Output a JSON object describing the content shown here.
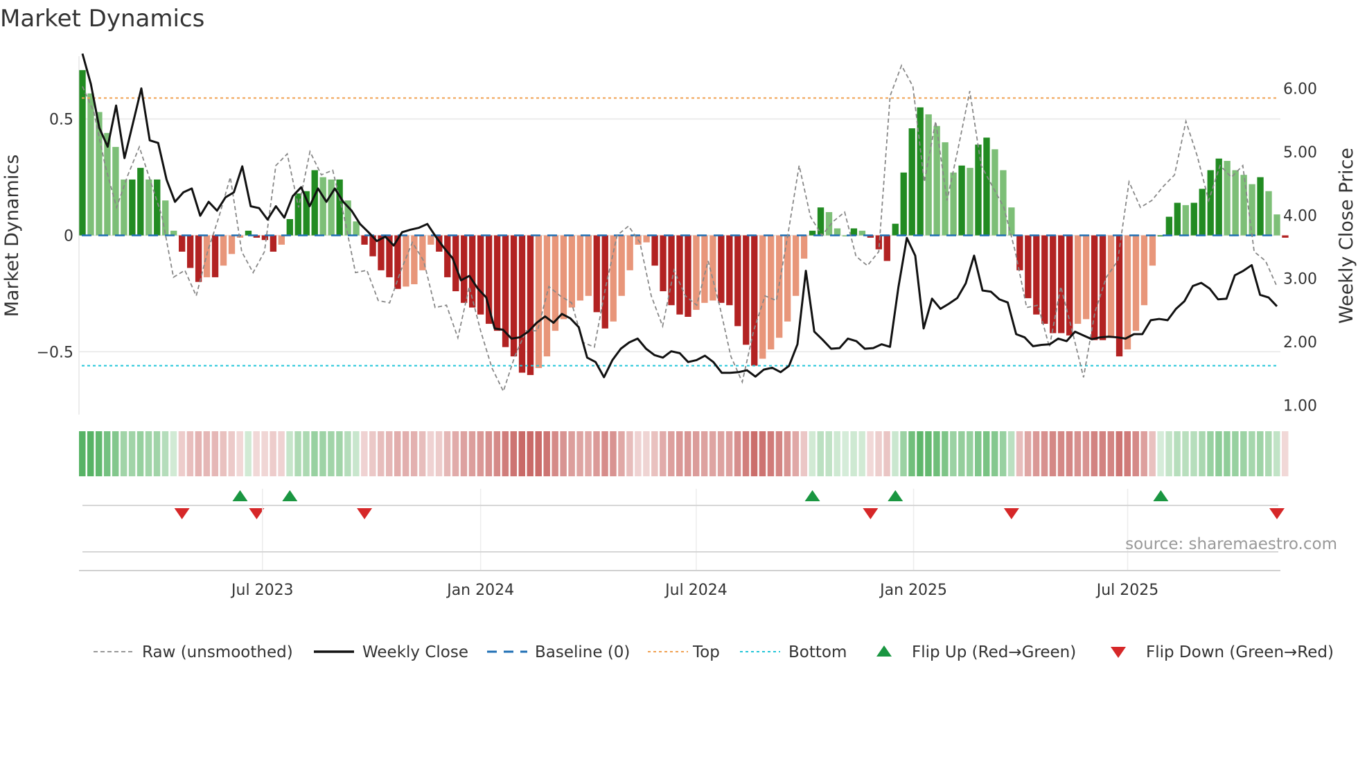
{
  "title": "Market Dynamics",
  "source": "source: sharemaestro.com",
  "colors": {
    "strong_up": "#228b22",
    "weak_up": "#7dbf77",
    "strong_down": "#b22222",
    "weak_down": "#e8967a",
    "raw": "#888888",
    "close": "#111111",
    "baseline": "#1f6fb4",
    "top": "#f0a050",
    "bottom": "#22c5d8",
    "flip_up": "#1a9641",
    "flip_down": "#d62728"
  },
  "chart_data": {
    "type": "bar",
    "title": "Market Dynamics",
    "ylabel": "Market Dynamics",
    "y2label": "Weekly Close Price",
    "ylim": [
      -0.77,
      0.77
    ],
    "y2lim": [
      0.85,
      6.51
    ],
    "yticks": [
      {
        "v": 0.5,
        "label": "0.5"
      },
      {
        "v": 0,
        "label": "0"
      },
      {
        "v": -0.5,
        "label": "−0.5"
      }
    ],
    "y2ticks": [
      {
        "v": 6,
        "label": "6.00"
      },
      {
        "v": 5,
        "label": "5.00"
      },
      {
        "v": 4,
        "label": "4.00"
      },
      {
        "v": 3,
        "label": "3.00"
      },
      {
        "v": 2,
        "label": "2.00"
      },
      {
        "v": 1,
        "label": "1.00"
      }
    ],
    "xticks": [
      {
        "week": 21.7,
        "label": "Jul 2023"
      },
      {
        "week": 48,
        "label": "Jan 2024"
      },
      {
        "week": 74,
        "label": "Jul 2024"
      },
      {
        "week": 100.2,
        "label": "Jan 2025"
      },
      {
        "week": 126,
        "label": "Jul 2025"
      }
    ],
    "n_weeks": 145,
    "top_level": 0.59,
    "bottom_level": -0.56,
    "baseline": 0,
    "dynamics": [
      0.71,
      0.61,
      0.53,
      0.44,
      0.38,
      0.24,
      0.24,
      0.29,
      0.24,
      0.24,
      0.15,
      0.02,
      -0.07,
      -0.14,
      -0.2,
      -0.18,
      -0.18,
      -0.13,
      -0.08,
      -0.01,
      0.02,
      -0.01,
      -0.02,
      -0.07,
      -0.04,
      0.07,
      0.18,
      0.19,
      0.28,
      0.25,
      0.24,
      0.24,
      0.15,
      0.06,
      -0.04,
      -0.09,
      -0.15,
      -0.18,
      -0.23,
      -0.22,
      -0.21,
      -0.15,
      -0.04,
      -0.07,
      -0.18,
      -0.24,
      -0.29,
      -0.31,
      -0.34,
      -0.38,
      -0.41,
      -0.48,
      -0.52,
      -0.59,
      -0.6,
      -0.57,
      -0.52,
      -0.41,
      -0.36,
      -0.31,
      -0.28,
      -0.26,
      -0.33,
      -0.4,
      -0.37,
      -0.26,
      -0.15,
      -0.04,
      -0.03,
      -0.13,
      -0.24,
      -0.3,
      -0.34,
      -0.35,
      -0.32,
      -0.29,
      -0.28,
      -0.29,
      -0.3,
      -0.39,
      -0.47,
      -0.56,
      -0.53,
      -0.49,
      -0.44,
      -0.37,
      -0.26,
      -0.1,
      0.02,
      0.12,
      0.1,
      0.03,
      0.0,
      0.03,
      0.02,
      -0.01,
      -0.06,
      -0.11,
      0.05,
      0.27,
      0.46,
      0.55,
      0.52,
      0.47,
      0.4,
      0.27,
      0.3,
      0.29,
      0.39,
      0.42,
      0.37,
      0.28,
      0.12,
      -0.15,
      -0.27,
      -0.34,
      -0.38,
      -0.42,
      -0.42,
      -0.43,
      -0.38,
      -0.36,
      -0.45,
      -0.45,
      -0.44,
      -0.52,
      -0.49,
      -0.41,
      -0.3,
      -0.13,
      0.0,
      0.08,
      0.14,
      0.13,
      0.14,
      0.2,
      0.28,
      0.33,
      0.32,
      0.28,
      0.26,
      0.22,
      0.25,
      0.19,
      0.09,
      -0.01
    ],
    "raw": [
      0.64,
      0.53,
      0.3,
      0.12,
      0.26,
      0.38,
      0.23,
      0.08,
      -0.18,
      -0.15,
      -0.26,
      -0.07,
      0.08,
      0.25,
      -0.07,
      -0.16,
      -0.07,
      0.3,
      0.35,
      0.12,
      0.36,
      0.26,
      0.28,
      0.08,
      -0.16,
      -0.15,
      -0.28,
      -0.29,
      -0.15,
      -0.03,
      -0.11,
      -0.31,
      -0.3,
      -0.44,
      -0.22,
      -0.41,
      -0.57,
      -0.67,
      -0.52,
      -0.41,
      -0.41,
      -0.22,
      -0.26,
      -0.29,
      -0.46,
      -0.48,
      -0.22,
      0.0,
      0.04,
      -0.03,
      -0.26,
      -0.39,
      -0.15,
      -0.26,
      -0.3,
      -0.11,
      -0.3,
      -0.52,
      -0.63,
      -0.41,
      -0.26,
      -0.28,
      0.0,
      0.3,
      0.08,
      0.0,
      0.06,
      0.1,
      -0.09,
      -0.13,
      -0.07,
      0.6,
      0.73,
      0.64,
      0.23,
      0.49,
      0.15,
      0.38,
      0.62,
      0.3,
      0.21,
      0.12,
      -0.07,
      -0.31,
      -0.3,
      -0.48,
      -0.22,
      -0.41,
      -0.61,
      -0.33,
      -0.18,
      -0.11,
      0.23,
      0.12,
      0.15,
      0.21,
      0.26,
      0.49,
      0.34,
      0.15,
      0.3,
      0.25,
      0.3,
      -0.07,
      -0.11,
      -0.22
    ],
    "weekly_close": [
      6.55,
      6.07,
      5.38,
      5.08,
      5.73,
      4.9,
      5.45,
      6.0,
      5.18,
      5.14,
      4.56,
      4.21,
      4.36,
      4.42,
      3.99,
      4.21,
      4.07,
      4.28,
      4.36,
      4.77,
      4.14,
      4.11,
      3.93,
      4.14,
      3.96,
      4.3,
      4.44,
      4.14,
      4.42,
      4.21,
      4.42,
      4.21,
      4.07,
      3.86,
      3.73,
      3.59,
      3.66,
      3.52,
      3.73,
      3.77,
      3.8,
      3.86,
      3.66,
      3.48,
      3.32,
      2.97,
      3.04,
      2.84,
      2.7,
      2.21,
      2.19,
      2.05,
      2.07,
      2.16,
      2.3,
      2.4,
      2.3,
      2.44,
      2.37,
      2.23,
      1.75,
      1.68,
      1.44,
      1.71,
      1.89,
      1.99,
      2.05,
      1.89,
      1.79,
      1.75,
      1.85,
      1.82,
      1.68,
      1.71,
      1.78,
      1.68,
      1.51,
      1.51,
      1.52,
      1.55,
      1.45,
      1.56,
      1.59,
      1.52,
      1.62,
      1.96,
      3.12,
      2.16,
      2.03,
      1.89,
      1.9,
      2.05,
      2.01,
      1.89,
      1.9,
      1.96,
      1.92,
      2.86,
      3.64,
      3.36,
      2.21,
      2.68,
      2.52,
      2.6,
      2.69,
      2.92,
      3.36,
      2.81,
      2.79,
      2.67,
      2.62,
      2.12,
      2.07,
      1.93,
      1.95,
      1.96,
      2.05,
      2.01,
      2.16,
      2.1,
      2.04,
      2.07,
      2.08,
      2.07,
      2.05,
      2.12,
      2.12,
      2.34,
      2.36,
      2.34,
      2.52,
      2.64,
      2.88,
      2.93,
      2.84,
      2.67,
      2.68,
      3.05,
      3.12,
      3.21,
      2.74,
      2.7,
      2.56
    ],
    "flip_up_weeks": [
      19,
      25,
      88,
      98,
      130
    ],
    "flip_down_weeks": [
      12,
      21,
      34,
      95,
      112,
      144
    ],
    "legend": [
      {
        "key": "raw",
        "label": "Raw (unsmoothed)"
      },
      {
        "key": "close",
        "label": "Weekly Close"
      },
      {
        "key": "baseline",
        "label": "Baseline (0)"
      },
      {
        "key": "top",
        "label": "Top"
      },
      {
        "key": "bottom",
        "label": "Bottom"
      },
      {
        "key": "flip_up",
        "label": "Flip Up (Red→Green)"
      },
      {
        "key": "flip_down",
        "label": "Flip Down (Green→Red)"
      }
    ],
    "legend_position": "bottom"
  }
}
